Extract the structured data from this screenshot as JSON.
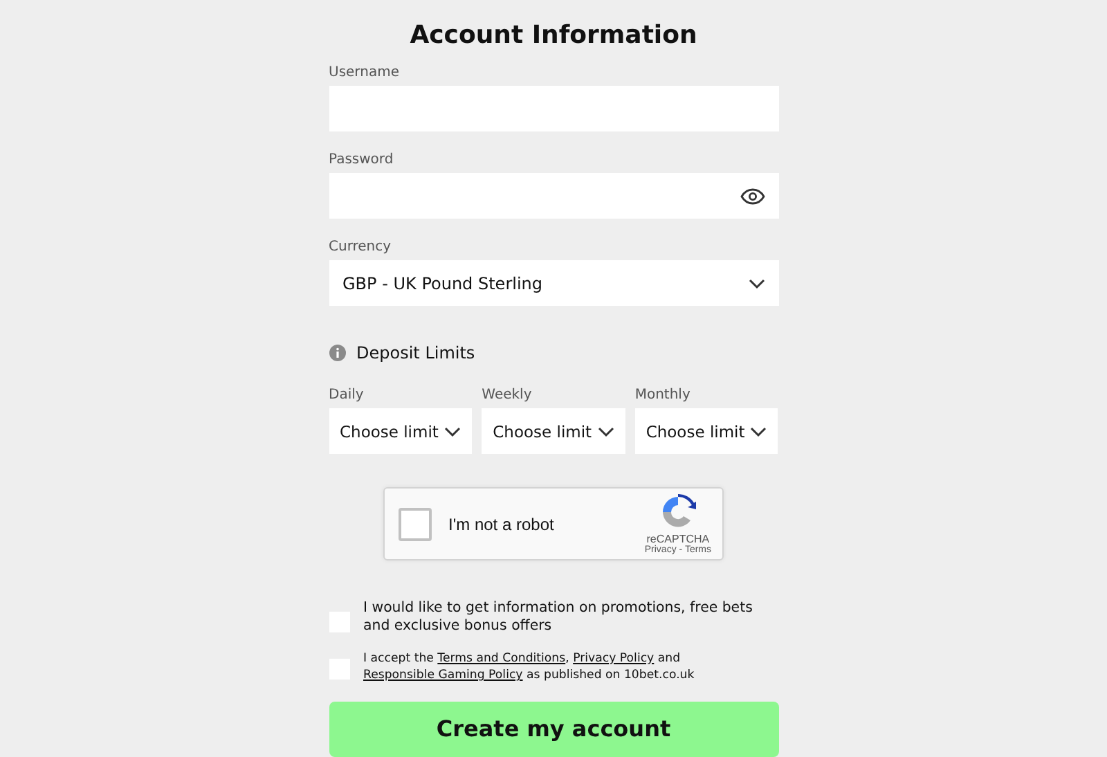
{
  "title": "Account Information",
  "fields": [
    {
      "kind": "text",
      "label": "Username"
    },
    {
      "kind": "password",
      "label": "Password"
    },
    {
      "kind": "select",
      "label": "Currency",
      "value": "GBP - UK Pound Sterling"
    }
  ],
  "deposit_limits": {
    "heading": "Deposit Limits",
    "limits": [
      {
        "label": "Daily",
        "value": "Choose limit"
      },
      {
        "label": "Weekly",
        "value": "Choose limit"
      },
      {
        "label": "Monthly",
        "value": "Choose limit"
      }
    ]
  },
  "captcha": {
    "label": "I'm not a robot",
    "checked": false,
    "brand": "reCAPTCHA",
    "privacy": "Privacy",
    "separator": " - ",
    "terms": "Terms"
  },
  "consents": [
    {
      "checked": false,
      "kind": "promo",
      "parts": [
        {
          "kind": "text",
          "text": "I would like to get information on promotions, free bets and exclusive bonus offers"
        }
      ]
    },
    {
      "checked": false,
      "kind": "legal",
      "parts": [
        {
          "kind": "text",
          "text": "I accept the "
        },
        {
          "kind": "link",
          "text": "Terms and Conditions"
        },
        {
          "kind": "text",
          "text": ", "
        },
        {
          "kind": "link",
          "text": "Privacy Policy"
        },
        {
          "kind": "text",
          "text": " and "
        },
        {
          "kind": "link",
          "text": "Responsible Gaming Policy"
        },
        {
          "kind": "text",
          "text": " as published on 10bet.co.uk"
        }
      ]
    }
  ],
  "submit": "Create my account"
}
